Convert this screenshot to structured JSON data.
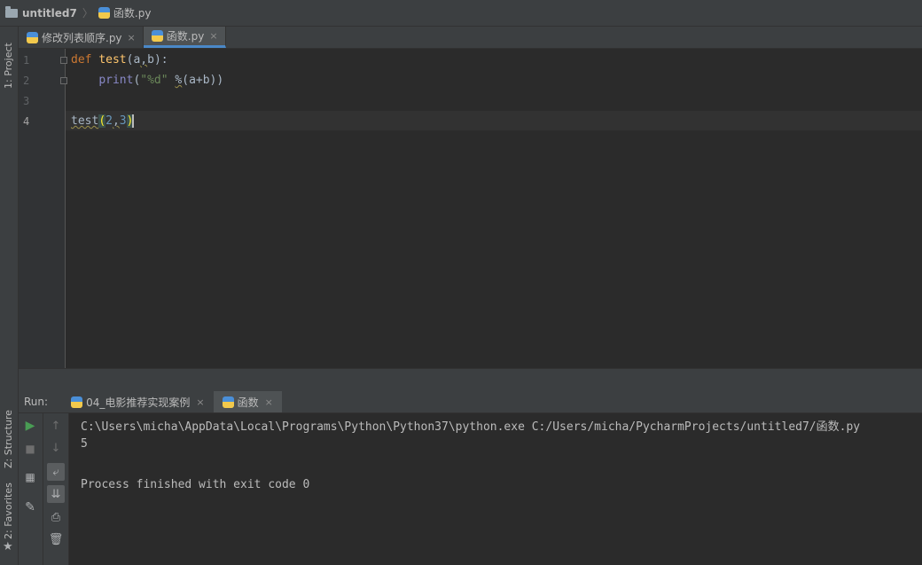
{
  "breadcrumb": {
    "project": "untitled7",
    "file": "函数.py"
  },
  "side_tabs": {
    "project": "1: Project",
    "structure": "Z: Structure",
    "favorites": "2: Favorites"
  },
  "editor_tabs": [
    {
      "label": "修改列表顺序.py",
      "close": "×"
    },
    {
      "label": "函数.py",
      "close": "×"
    }
  ],
  "line_numbers": [
    "1",
    "2",
    "3",
    "4"
  ],
  "code": {
    "l1_def": "def",
    "l1_name": "test",
    "l1_open": "(",
    "l1_a": "a",
    "l1_comma": ",",
    "l1_b": "b",
    "l1_close": "):",
    "l2_indent": "    ",
    "l2_print": "print",
    "l2_open": "(",
    "l2_str": "\"%d\"",
    "l2_space": " ",
    "l2_pct": "%",
    "l2_args": "(a+b))",
    "l4_name": "test",
    "l4_open": "(",
    "l4_n1": "2",
    "l4_comma": ",",
    "l4_n2": "3",
    "l4_close": ")"
  },
  "run": {
    "label": "Run:",
    "tabs": [
      {
        "label": "04_电影推荐实现案例",
        "close": "×"
      },
      {
        "label": "函数",
        "close": "×"
      }
    ]
  },
  "console": {
    "command": "C:\\Users\\micha\\AppData\\Local\\Programs\\Python\\Python37\\python.exe C:/Users/micha/PycharmProjects/untitled7/函数.py",
    "output": "5",
    "finish": "Process finished with exit code 0"
  },
  "colors": {
    "accent": "#4a88c7",
    "run_green": "#499c54",
    "keyword": "#cc7832",
    "function": "#ffc66d",
    "string": "#6a8759",
    "number": "#6897bb"
  },
  "icons": [
    "folder-icon",
    "python-file-icon",
    "run-icon",
    "stop-icon",
    "layout-icon",
    "pin-icon",
    "up-arrow-icon",
    "down-arrow-icon",
    "soft-wrap-icon",
    "scroll-to-end-icon",
    "print-icon",
    "trash-icon",
    "star-icon"
  ]
}
